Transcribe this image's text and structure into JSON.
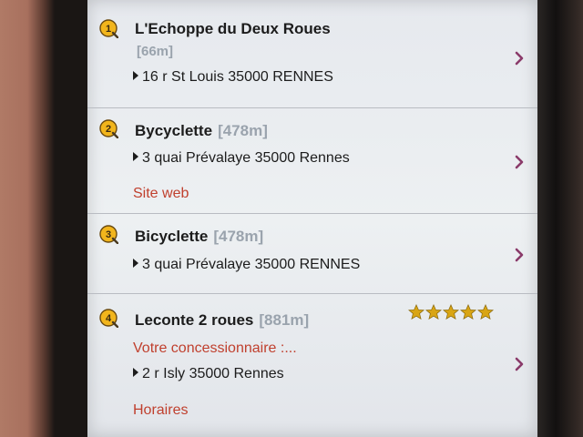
{
  "results": [
    {
      "number": "1",
      "name": "L'Echoppe du Deux Roues",
      "distance": "[66m]",
      "address": "16 r St Louis 35000 RENNES"
    },
    {
      "number": "2",
      "name": "Bycyclette",
      "distance": "[478m]",
      "address": "3 quai Prévalaye 35000 Rennes",
      "link": "Site web"
    },
    {
      "number": "3",
      "name": "Bicyclette",
      "distance": "[478m]",
      "address": "3 quai Prévalaye 35000 RENNES"
    },
    {
      "number": "4",
      "name": "Leconte 2 roues",
      "distance": "[881m]",
      "tagline": "Votre concessionnaire :...",
      "address": "2 r Isly 35000 Rennes",
      "link": "Horaires",
      "rating": 5
    }
  ],
  "colors": {
    "pin_fill": "#f2b51c",
    "link_red": "#c0402e",
    "chevron": "#8a3a6a",
    "star": "#d9a514"
  },
  "icons": {
    "pin": "numbered-map-pin-icon",
    "chevron": "chevron-right-icon",
    "star": "star-icon",
    "bullet": "triangle-bullet-icon"
  }
}
